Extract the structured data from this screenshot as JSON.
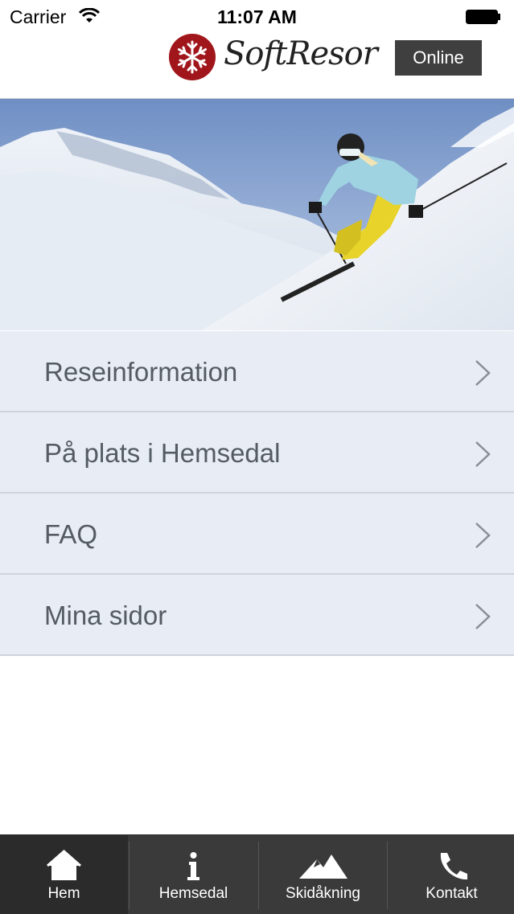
{
  "status_bar": {
    "carrier": "Carrier",
    "time": "11:07 AM"
  },
  "header": {
    "brand": "SoftResor",
    "online_button": "Online",
    "brand_color": "#a0161b"
  },
  "hero": {
    "image": "skier-on-slope"
  },
  "menu": {
    "items": [
      {
        "label": "Reseinformation",
        "icon": "chevron-right-icon"
      },
      {
        "label": "På plats i Hemsedal",
        "icon": "chevron-right-icon"
      },
      {
        "label": "FAQ",
        "icon": "chevron-right-icon"
      },
      {
        "label": "Mina sidor",
        "icon": "chevron-right-icon"
      }
    ]
  },
  "tabbar": {
    "tabs": [
      {
        "label": "Hem",
        "icon": "home-icon",
        "active": true
      },
      {
        "label": "Hemsedal",
        "icon": "info-icon",
        "active": false
      },
      {
        "label": "Skidåkning",
        "icon": "mountain-icon",
        "active": false
      },
      {
        "label": "Kontakt",
        "icon": "phone-icon",
        "active": false
      }
    ]
  }
}
